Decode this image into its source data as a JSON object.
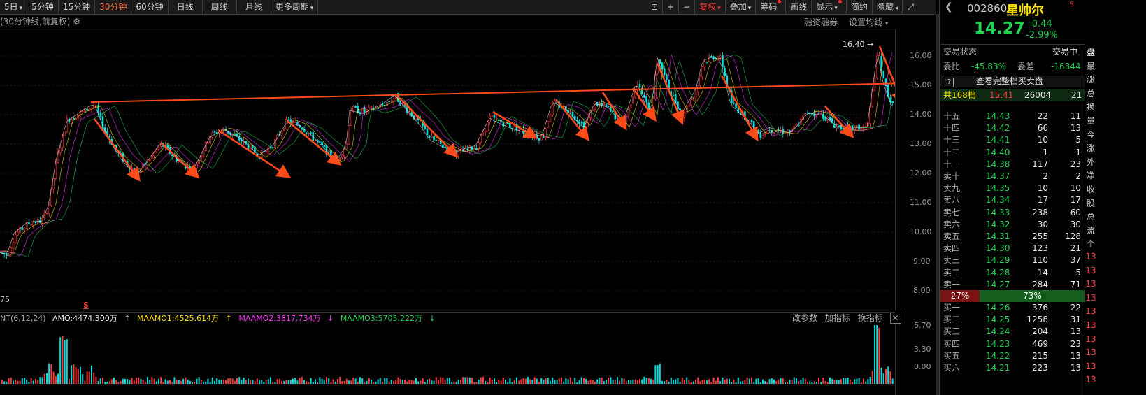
{
  "toolbar": {
    "periods": [
      "5日",
      "5分钟",
      "15分钟",
      "30分钟",
      "60分钟",
      "日线",
      "周线",
      "月线",
      "更多周期"
    ],
    "active_period": "30分钟",
    "right_buttons": [
      "复权",
      "叠加",
      "筹码",
      "画线",
      "显示",
      "简约",
      "隐藏"
    ]
  },
  "chart": {
    "subtitle": "(30分钟线,前复权)",
    "links": [
      "融资融券",
      "设置均线"
    ],
    "high_label": "16.40",
    "price_ticks": [
      "16.00",
      "15.00",
      "14.00",
      "13.00",
      "12.00",
      "11.00",
      "10.00",
      "9.00",
      "8.00"
    ],
    "left_edge_label": "75",
    "signal_mark": "S"
  },
  "indicator": {
    "name": "NT(6,12,24)",
    "amo": "AMO:4474.300万",
    "maamo1": "MAAMO1:4525.614万",
    "maamo2": "MAAMO2:3817.734万",
    "maamo3": "MAAMO3:5705.222万",
    "actions": [
      "改参数",
      "加指标",
      "换指标"
    ],
    "ticks": [
      "6.70",
      "3.30",
      "0.00"
    ]
  },
  "stock": {
    "code": "002860",
    "name": "星帅尔",
    "price": "14.27",
    "change": "-0.44",
    "change_pct": "-2.99%",
    "status_label": "交易状态",
    "status_value": "交易中",
    "ratio_label": "委比",
    "ratio_value": "-45.83%",
    "diff_label": "委差",
    "diff_value": "-16344",
    "full_book": "查看完整档买卖盘",
    "total_label": "共168档",
    "total_price": "15.41",
    "total_vol": "26004",
    "total_cnt": "21",
    "sell_pct": "27%",
    "buy_pct": "73%"
  },
  "asks": [
    {
      "label": "十五",
      "price": "14.43",
      "vol": "22",
      "cnt": "11"
    },
    {
      "label": "十四",
      "price": "14.42",
      "vol": "66",
      "cnt": "13"
    },
    {
      "label": "十三",
      "price": "14.41",
      "vol": "10",
      "cnt": "5"
    },
    {
      "label": "十二",
      "price": "14.40",
      "vol": "1",
      "cnt": "1"
    },
    {
      "label": "十一",
      "price": "14.38",
      "vol": "117",
      "cnt": "23"
    },
    {
      "label": "卖十",
      "price": "14.37",
      "vol": "2",
      "cnt": "2"
    },
    {
      "label": "卖九",
      "price": "14.35",
      "vol": "10",
      "cnt": "10"
    },
    {
      "label": "卖八",
      "price": "14.34",
      "vol": "17",
      "cnt": "17"
    },
    {
      "label": "卖七",
      "price": "14.33",
      "vol": "238",
      "cnt": "60"
    },
    {
      "label": "卖六",
      "price": "14.32",
      "vol": "30",
      "cnt": "30"
    },
    {
      "label": "卖五",
      "price": "14.31",
      "vol": "255",
      "cnt": "128"
    },
    {
      "label": "卖四",
      "price": "14.30",
      "vol": "123",
      "cnt": "21"
    },
    {
      "label": "卖三",
      "price": "14.29",
      "vol": "110",
      "cnt": "37"
    },
    {
      "label": "卖二",
      "price": "14.28",
      "vol": "14",
      "cnt": "5"
    },
    {
      "label": "卖一",
      "price": "14.27",
      "vol": "284",
      "cnt": "71"
    }
  ],
  "bids": [
    {
      "label": "买一",
      "price": "14.26",
      "vol": "376",
      "cnt": "22"
    },
    {
      "label": "买二",
      "price": "14.25",
      "vol": "1258",
      "cnt": "31"
    },
    {
      "label": "买三",
      "price": "14.24",
      "vol": "204",
      "cnt": "13"
    },
    {
      "label": "买四",
      "price": "14.23",
      "vol": "469",
      "cnt": "23"
    },
    {
      "label": "买五",
      "price": "14.22",
      "vol": "215",
      "cnt": "13"
    },
    {
      "label": "买六",
      "price": "14.21",
      "vol": "223",
      "cnt": "13"
    }
  ],
  "side_tabs": [
    "盘",
    "最",
    "涨",
    "总",
    "换",
    "量",
    "今",
    "涨",
    "外",
    "净",
    "收",
    "股",
    "总",
    "流",
    "个",
    "13",
    "13",
    "13",
    "13",
    "13",
    "13",
    "13",
    "13",
    "13",
    "13"
  ],
  "colors": {
    "up": "#ff3b3b",
    "down": "#20d050",
    "line": "#00e0e0",
    "arrow": "#ff4a1a"
  }
}
